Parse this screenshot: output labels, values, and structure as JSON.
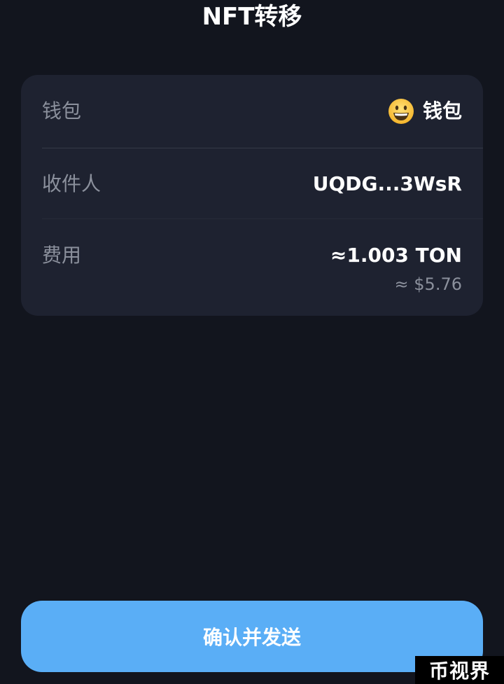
{
  "header": {
    "title": "NFT转移"
  },
  "details": {
    "wallet": {
      "label": "钱包",
      "icon": "grinning-face-emoji",
      "value": "钱包"
    },
    "recipient": {
      "label": "收件人",
      "value": "UQDG...3WsR"
    },
    "fee": {
      "label": "费用",
      "value": "≈1.003 TON",
      "fiat": "≈ $5.76"
    }
  },
  "actions": {
    "confirm_label": "确认并发送"
  },
  "watermark": {
    "text": "币视界"
  },
  "colors": {
    "background": "#12151e",
    "card": "#1e2230",
    "accent": "#5aaef6",
    "muted_text": "#8b909c"
  }
}
